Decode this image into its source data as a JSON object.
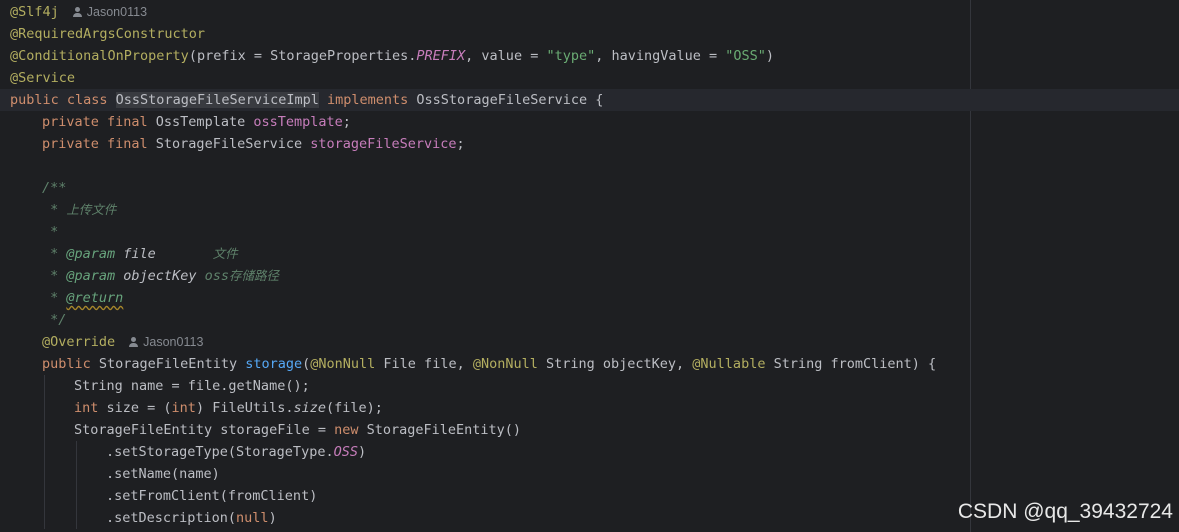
{
  "lines": [
    {
      "indent": 0,
      "current": false,
      "tokens": [
        [
          "annotation",
          "@Slf4j"
        ]
      ],
      "author": "Jason0113"
    },
    {
      "indent": 0,
      "current": false,
      "tokens": [
        [
          "annotation",
          "@RequiredArgsConstructor"
        ]
      ]
    },
    {
      "indent": 0,
      "current": false,
      "tokens": [
        [
          "annotation",
          "@ConditionalOnProperty"
        ],
        [
          "plain",
          "(prefix = StorageProperties."
        ],
        [
          "const",
          "PREFIX"
        ],
        [
          "plain",
          ", value = "
        ],
        [
          "string",
          "\"type\""
        ],
        [
          "plain",
          ", havingValue = "
        ],
        [
          "string",
          "\"OSS\""
        ],
        [
          "plain",
          ")"
        ]
      ]
    },
    {
      "indent": 0,
      "current": false,
      "tokens": [
        [
          "annotation",
          "@Service"
        ]
      ]
    },
    {
      "indent": 0,
      "current": true,
      "tokens": [
        [
          "keyword",
          "public class "
        ],
        [
          "class-hl",
          "OssStorageFileServiceImpl"
        ],
        [
          "plain",
          " "
        ],
        [
          "keyword",
          "implements "
        ],
        [
          "plain",
          "OssStorageFileService {"
        ]
      ]
    },
    {
      "indent": 1,
      "current": false,
      "tokens": [
        [
          "keyword",
          "private final "
        ],
        [
          "plain",
          "OssTemplate "
        ],
        [
          "field",
          "ossTemplate"
        ],
        [
          "plain",
          ";"
        ]
      ]
    },
    {
      "indent": 1,
      "current": false,
      "tokens": [
        [
          "keyword",
          "private final "
        ],
        [
          "plain",
          "StorageFileService "
        ],
        [
          "field",
          "storageFileService"
        ],
        [
          "plain",
          ";"
        ]
      ]
    },
    {
      "indent": 1,
      "current": false,
      "tokens": []
    },
    {
      "indent": 1,
      "current": false,
      "tokens": [
        [
          "doc",
          "/**"
        ]
      ]
    },
    {
      "indent": 1,
      "current": false,
      "tokens": [
        [
          "doc",
          " * "
        ],
        [
          "doc-cjk",
          "上传文件"
        ]
      ]
    },
    {
      "indent": 1,
      "current": false,
      "tokens": [
        [
          "doc",
          " *"
        ]
      ]
    },
    {
      "indent": 1,
      "current": false,
      "tokens": [
        [
          "doc",
          " * "
        ],
        [
          "doctag",
          "@param "
        ],
        [
          "docparam",
          "file"
        ],
        [
          "doc",
          "       "
        ],
        [
          "doc-cjk",
          "文件"
        ]
      ]
    },
    {
      "indent": 1,
      "current": false,
      "tokens": [
        [
          "doc",
          " * "
        ],
        [
          "doctag",
          "@param "
        ],
        [
          "docparam",
          "objectKey "
        ],
        [
          "doc",
          "oss"
        ],
        [
          "doc-cjk",
          "存储路径"
        ]
      ]
    },
    {
      "indent": 1,
      "current": false,
      "tokens": [
        [
          "doc",
          " * "
        ],
        [
          "doctag-warn",
          "@return"
        ]
      ]
    },
    {
      "indent": 1,
      "current": false,
      "tokens": [
        [
          "doc",
          " */"
        ]
      ]
    },
    {
      "indent": 1,
      "current": false,
      "tokens": [
        [
          "annotation",
          "@Override"
        ]
      ],
      "author": "Jason0113"
    },
    {
      "indent": 1,
      "current": false,
      "tokens": [
        [
          "keyword",
          "public "
        ],
        [
          "plain",
          "StorageFileEntity "
        ],
        [
          "method-decl",
          "storage"
        ],
        [
          "plain",
          "("
        ],
        [
          "annotation",
          "@NonNull "
        ],
        [
          "plain",
          "File file, "
        ],
        [
          "annotation",
          "@NonNull "
        ],
        [
          "plain",
          "String objectKey, "
        ],
        [
          "annotation",
          "@Nullable "
        ],
        [
          "plain",
          "String fromClient) {"
        ]
      ]
    },
    {
      "indent": 2,
      "current": false,
      "tokens": [
        [
          "plain",
          "String name = file.getName();"
        ]
      ]
    },
    {
      "indent": 2,
      "current": false,
      "tokens": [
        [
          "keyword",
          "int "
        ],
        [
          "plain",
          "size = ("
        ],
        [
          "keyword",
          "int"
        ],
        [
          "plain",
          ") FileUtils."
        ],
        [
          "static",
          "size"
        ],
        [
          "plain",
          "(file);"
        ]
      ]
    },
    {
      "indent": 2,
      "current": false,
      "tokens": [
        [
          "plain",
          "StorageFileEntity storageFile = "
        ],
        [
          "keyword",
          "new "
        ],
        [
          "plain",
          "StorageFileEntity()"
        ]
      ]
    },
    {
      "indent": 3,
      "current": false,
      "tokens": [
        [
          "plain",
          ".setStorageType(StorageType."
        ],
        [
          "const",
          "OSS"
        ],
        [
          "plain",
          ")"
        ]
      ]
    },
    {
      "indent": 3,
      "current": false,
      "tokens": [
        [
          "plain",
          ".setName(name)"
        ]
      ]
    },
    {
      "indent": 3,
      "current": false,
      "tokens": [
        [
          "plain",
          ".setFromClient(fromClient)"
        ]
      ]
    },
    {
      "indent": 3,
      "current": false,
      "tokens": [
        [
          "plain",
          ".setDescription("
        ],
        [
          "keyword",
          "null"
        ],
        [
          "plain",
          ")"
        ]
      ]
    }
  ],
  "watermark": "CSDN @qq_39432724",
  "colors": {
    "background": "#1e1f22",
    "annotation": "#b3ae60",
    "keyword": "#cf8e6d",
    "string": "#6aab73",
    "field": "#c77dbb",
    "method_decl": "#56a8f5",
    "doc_comment": "#5f826b"
  },
  "icons": {
    "author": "person-icon"
  }
}
